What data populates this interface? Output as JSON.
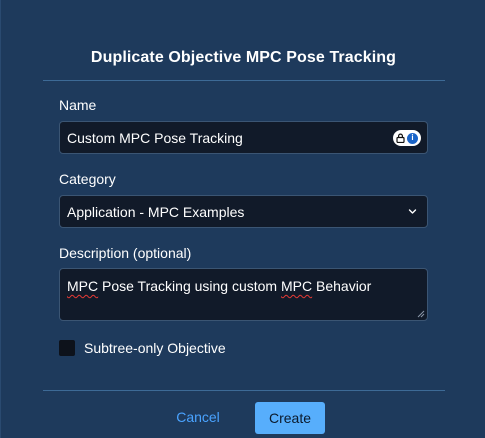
{
  "dialog": {
    "title": "Duplicate Objective MPC Pose Tracking"
  },
  "form": {
    "name": {
      "label": "Name",
      "value": "Custom MPC Pose Tracking"
    },
    "category": {
      "label": "Category",
      "selected": "Application - MPC Examples"
    },
    "description": {
      "label": "Description (optional)",
      "value_parts": [
        "MPC",
        " Pose Tracking using custom ",
        "MPC",
        " Behavior"
      ]
    },
    "subtree_only": {
      "label": "Subtree-only Objective",
      "checked": false
    }
  },
  "actions": {
    "cancel_label": "Cancel",
    "create_label": "Create"
  },
  "icons": {
    "password_manager": "password-manager-icon",
    "dropdown": "chevron-down-icon",
    "resize": "resize-handle-icon"
  },
  "colors": {
    "dialog_bg": "#1e3a5c",
    "field_bg": "#111a29",
    "accent": "#57aefc",
    "link": "#4aa3ff",
    "spellcheck": "#e53935"
  }
}
